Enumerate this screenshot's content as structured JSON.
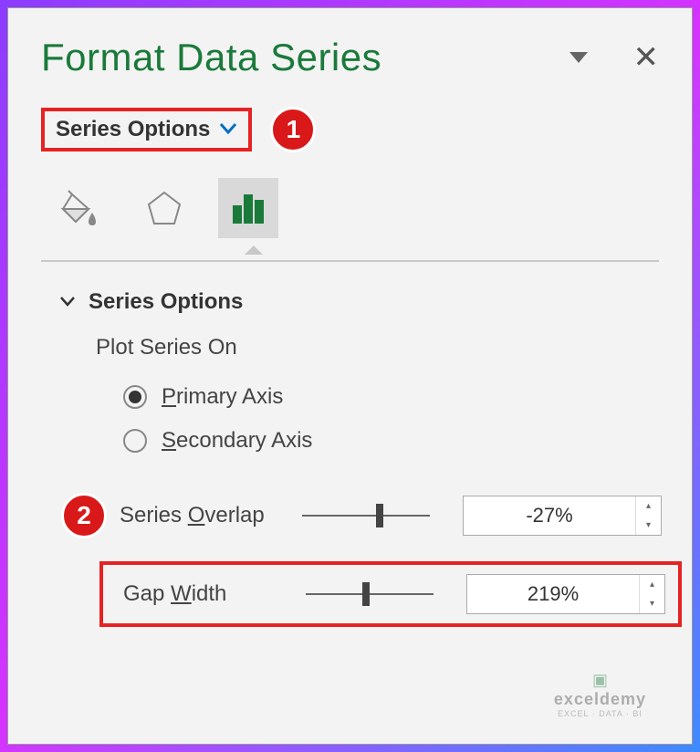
{
  "header": {
    "title": "Format Data Series"
  },
  "dropdown": {
    "label": "Series Options"
  },
  "callouts": {
    "one": "1",
    "two": "2"
  },
  "tabs": {
    "fill_icon": "fill-effects-icon",
    "effects_icon": "effects-icon",
    "series_icon": "series-options-icon"
  },
  "section": {
    "title": "Series Options",
    "plot_label": "Plot Series On",
    "primary_axis_prefix": "P",
    "primary_axis_rest": "rimary Axis",
    "secondary_axis_prefix": "S",
    "secondary_axis_rest": "econdary Axis"
  },
  "sliders": {
    "overlap_label_pre": "Series ",
    "overlap_label_u": "O",
    "overlap_label_post": "verlap",
    "overlap_value": "-27%",
    "overlap_thumb_percent": 58,
    "gap_label_pre": "Gap ",
    "gap_label_u": "W",
    "gap_label_post": "idth",
    "gap_value": "219%",
    "gap_thumb_percent": 44
  },
  "watermark": {
    "name": "exceldemy",
    "sub": "EXCEL · DATA · BI"
  },
  "colors": {
    "accent_green": "#1a7a3a",
    "callout_red": "#e62222"
  }
}
